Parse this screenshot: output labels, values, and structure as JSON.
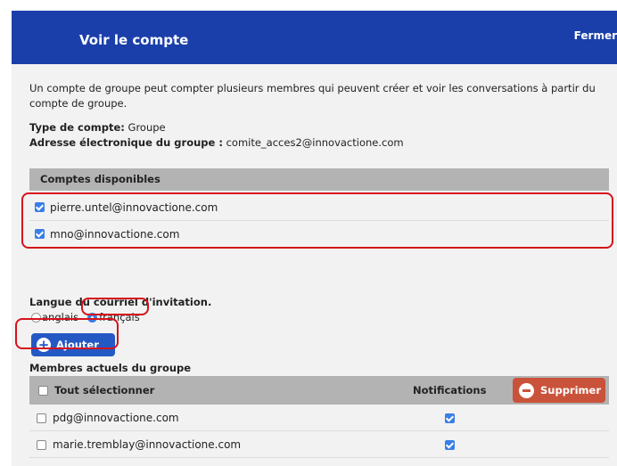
{
  "header": {
    "title": "Voir le compte",
    "close_label": "Fermer"
  },
  "description": "Un compte de groupe peut compter plusieurs membres qui peuvent créer et voir les conversations à partir du compte de groupe.",
  "account": {
    "type_label": "Type de compte:",
    "type_value": "Groupe",
    "email_label": "Adresse électronique du groupe :",
    "email_value": "comite_acces2@innovactione.com"
  },
  "available": {
    "header": "Comptes disponibles",
    "items": [
      {
        "email": "pierre.untel@innovactione.com",
        "checked": true
      },
      {
        "email": "mno@innovactione.com",
        "checked": true
      }
    ]
  },
  "invitation": {
    "label": "Langue du courriel d'invitation.",
    "options": [
      {
        "label": "anglais",
        "selected": false
      },
      {
        "label": "français",
        "selected": true
      }
    ]
  },
  "add_button": "Ajouter",
  "members": {
    "title": "Membres actuels du groupe",
    "select_all": "Tout sélectionner",
    "notifications_header": "Notifications",
    "delete_button": "Supprimer",
    "rows": [
      {
        "email": "pdg@innovactione.com",
        "selected": false,
        "notifications": true
      },
      {
        "email": "marie.tremblay@innovactione.com",
        "selected": false,
        "notifications": true
      }
    ]
  },
  "colors": {
    "header_bg": "#1b3faa",
    "accent": "#3a7ee6",
    "highlight": "#d6121b",
    "delete_bg": "#c9533a"
  }
}
